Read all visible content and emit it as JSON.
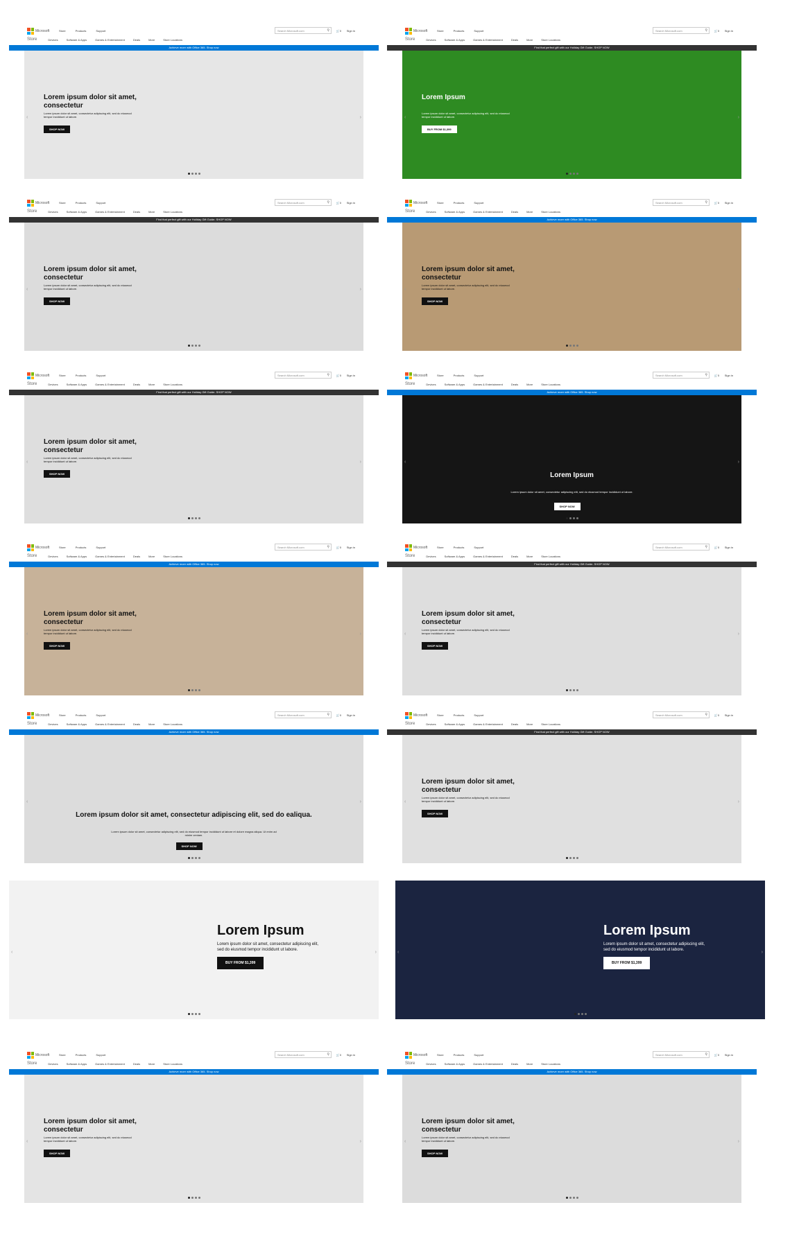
{
  "header": {
    "brand": "Microsoft",
    "store_label": "Store",
    "top_nav": [
      "Store",
      "Products",
      "Support"
    ],
    "search_placeholder": "Search Microsoft.com",
    "cart": "0",
    "sign_in": "Sign in",
    "sub_nav": [
      "Devices",
      "Software & Apps",
      "Games & Entertainment",
      "Deals",
      "More",
      "Store Locations"
    ]
  },
  "banners": {
    "office": "Achieve more with Office 365. Shop now",
    "gift": "Find that perfect gift with our Holiday Gift Guide. SHOP NOW"
  },
  "slides": [
    {
      "id": "headphones",
      "banner": "office",
      "title": "Lorem ipsum dolor sit amet, consectetur",
      "body": "Lorem ipsum dolor sit amet, consectetur adipiscing elit, sed do eiusmod tempor incididunt ut labore.",
      "button": "SHOP NOW",
      "bg": "#e6e6e6",
      "theme": "light"
    },
    {
      "id": "xbox-green",
      "banner": "gift",
      "title": "Lorem Ipsum",
      "body": "Lorem ipsum dolor sit amet, consectetur adipiscing elit, sed do eiusmod tempor incididunt ut labore.",
      "button": "BUY FROM $1,399",
      "bg": "#2e8b22",
      "theme": "dark"
    },
    {
      "id": "fitbit",
      "banner": "gift",
      "title": "Lorem ipsum dolor sit amet, consectetur",
      "body": "Lorem ipsum dolor sit amet, consectetur adipiscing elit, sed do eiusmod tempor incididunt ut labore.",
      "button": "SHOP NOW",
      "bg": "#dcdcdc",
      "theme": "light"
    },
    {
      "id": "speaker",
      "banner": "office",
      "title": "Lorem ipsum dolor sit amet, consectetur",
      "body": "Lorem ipsum dolor sit amet, consectetur adipiscing elit, sed do eiusmod tempor incididunt ut labore.",
      "button": "SHOP NOW",
      "bg": "#b89a74",
      "theme": "light"
    },
    {
      "id": "surface-studio",
      "banner": "gift",
      "title": "Lorem ipsum dolor sit amet, consectetur",
      "body": "Lorem ipsum dolor sit amet, consectetur adipiscing elit, sed do eiusmod tempor incididunt ut labore.",
      "button": "SHOP NOW",
      "bg": "#dedede",
      "theme": "light"
    },
    {
      "id": "xbox-dark",
      "banner": "office",
      "title": "Lorem Ipsum",
      "body": "Lorem ipsum dolor sit amet, consectetur adipiscing elit, sed do eiusmod tempor incididunt ut labore.",
      "button": "SHOP NOW",
      "bg": "#151515",
      "theme": "dark"
    },
    {
      "id": "surface-book",
      "banner": "office",
      "title": "Lorem ipsum dolor sit amet, consectetur",
      "body": "Lorem ipsum dolor sit amet, consectetur adipiscing elit, sed do eiusmod tempor incididunt ut labore.",
      "button": "SHOP NOW",
      "bg": "#c7b299",
      "theme": "light"
    },
    {
      "id": "laptop-silver",
      "banner": "gift",
      "title": "Lorem ipsum dolor sit amet, consectetur",
      "body": "Lorem ipsum dolor sit amet, consectetur adipiscing elit, sed do eiusmod tempor incididunt ut labore.",
      "button": "SHOP NOW",
      "bg": "#dedede",
      "theme": "light"
    },
    {
      "id": "surface-go",
      "banner": "office",
      "title": "Lorem ipsum dolor sit amet, consectetur adipiscing elit, sed do ealiqua.",
      "body": "Lorem ipsum dolor sit amet, consectetur adipiscing elit, sed do eiusmod tempor incididunt ut labore et dolore magna aliqua. Ut enim ad minim veniam.",
      "button": "SHOP NOW",
      "bg": "#dcdcdc",
      "theme": "light"
    },
    {
      "id": "surface-laptops",
      "banner": "gift",
      "title": "Lorem ipsum dolor sit amet, consectetur",
      "body": "Lorem ipsum dolor sit amet, consectetur adipiscing elit, sed do eiusmod tempor incididunt ut labore.",
      "button": "SHOP NOW",
      "bg": "#e0e0e0",
      "theme": "light"
    },
    {
      "id": "netatmo",
      "banner": "",
      "title": "Lorem Ipsum",
      "body": "Lorem ipsum dolor sit amet, consectetur adipiscing elit, sed do eiusmod tempor incididunt ut labore.",
      "button": "BUY FROM $1,399",
      "bg": "#f2f2f2",
      "theme": "light"
    },
    {
      "id": "fifa",
      "banner": "",
      "title": "Lorem Ipsum",
      "body": "Lorem ipsum dolor sit amet, consectetur adipiscing elit, sed do eiusmod tempor incididunt ut labore.",
      "button": "BUY FROM $1,399",
      "bg": "#1b2440",
      "theme": "dark"
    },
    {
      "id": "xbox-games",
      "banner": "office",
      "title": "Lorem ipsum dolor sit amet, consectetur",
      "body": "Lorem ipsum dolor sit amet, consectetur adipiscing elit, sed do eiusmod tempor incididunt ut labore.",
      "button": "SHOP NOW",
      "bg": "#e4e4e4",
      "theme": "light"
    },
    {
      "id": "surface-family",
      "banner": "office",
      "title": "Lorem ipsum dolor sit amet, consectetur",
      "body": "Lorem ipsum dolor sit amet, consectetur adipiscing elit, sed do eiusmod tempor incididunt ut labore.",
      "button": "SHOP NOW",
      "bg": "#dcdcdc",
      "theme": "light"
    }
  ]
}
